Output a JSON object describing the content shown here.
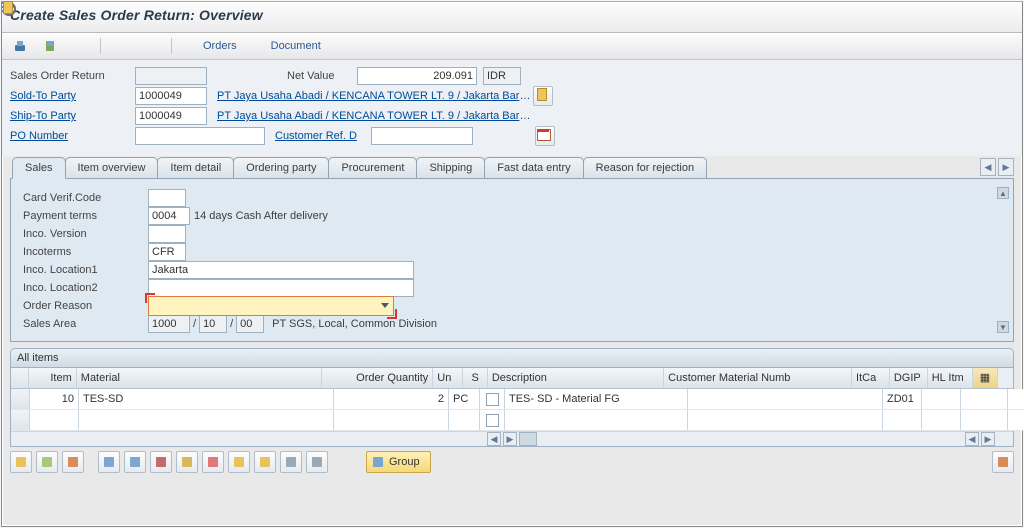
{
  "window": {
    "title": "Create Sales Order Return: Overview"
  },
  "toolbar": {
    "orders_label": "Orders",
    "document_label": "Document"
  },
  "header": {
    "sales_order_return_label": "Sales Order Return",
    "sales_order_return_value": "",
    "net_value_label": "Net Value",
    "net_value_amount": "209.091",
    "net_value_currency": "IDR",
    "sold_to_label": "Sold-To Party",
    "sold_to_value": "1000049",
    "sold_to_link": "PT Jaya Usaha Abadi / KENCANA TOWER LT. 9 / Jakarta Barat...",
    "ship_to_label": "Ship-To Party",
    "ship_to_value": "1000049",
    "ship_to_link": "PT Jaya Usaha Abadi / KENCANA TOWER LT. 9 / Jakarta Barat...",
    "po_number_label": "PO Number",
    "po_number_value": "",
    "cust_ref_label": "Customer Ref. D",
    "cust_ref_value": ""
  },
  "tabs": {
    "items": [
      "Sales",
      "Item overview",
      "Item detail",
      "Ordering party",
      "Procurement",
      "Shipping",
      "Fast data entry",
      "Reason for rejection"
    ],
    "active_index": 0
  },
  "sales": {
    "card_verif_label": "Card Verif.Code",
    "card_verif_value": "",
    "payment_terms_label": "Payment terms",
    "payment_terms_code": "0004",
    "payment_terms_text": "14 days Cash After delivery",
    "inco_version_label": "Inco. Version",
    "inco_version_value": "",
    "incoterms_label": "Incoterms",
    "incoterms_value": "CFR",
    "inco_loc1_label": "Inco. Location1",
    "inco_loc1_value": "Jakarta",
    "inco_loc2_label": "Inco. Location2",
    "inco_loc2_value": "",
    "order_reason_label": "Order Reason",
    "order_reason_value": "",
    "sales_area_label": "Sales Area",
    "sales_area_org": "1000",
    "sales_area_dist": "10",
    "sales_area_div": "00",
    "sales_area_text": "PT SGS, Local, Common Division"
  },
  "items_section": {
    "title": "All items",
    "columns": {
      "item": "Item",
      "material": "Material",
      "qty": "Order Quantity",
      "un": "Un",
      "s": "S",
      "desc": "Description",
      "cmn": "Customer Material Numb",
      "itca": "ItCa",
      "dgip": "DGIP",
      "hl": "HL Itm"
    },
    "rows": [
      {
        "item": "10",
        "material": "TES-SD",
        "qty": "2",
        "un": "PC",
        "s": false,
        "desc": "TES- SD - Material FG",
        "cmn": "",
        "itca": "ZD01",
        "dgip": "",
        "hl": ""
      },
      {
        "item": "",
        "material": "",
        "qty": "",
        "un": "",
        "s": false,
        "desc": "",
        "cmn": "",
        "itca": "",
        "dgip": "",
        "hl": ""
      }
    ]
  },
  "footer": {
    "group_label": "Group"
  }
}
